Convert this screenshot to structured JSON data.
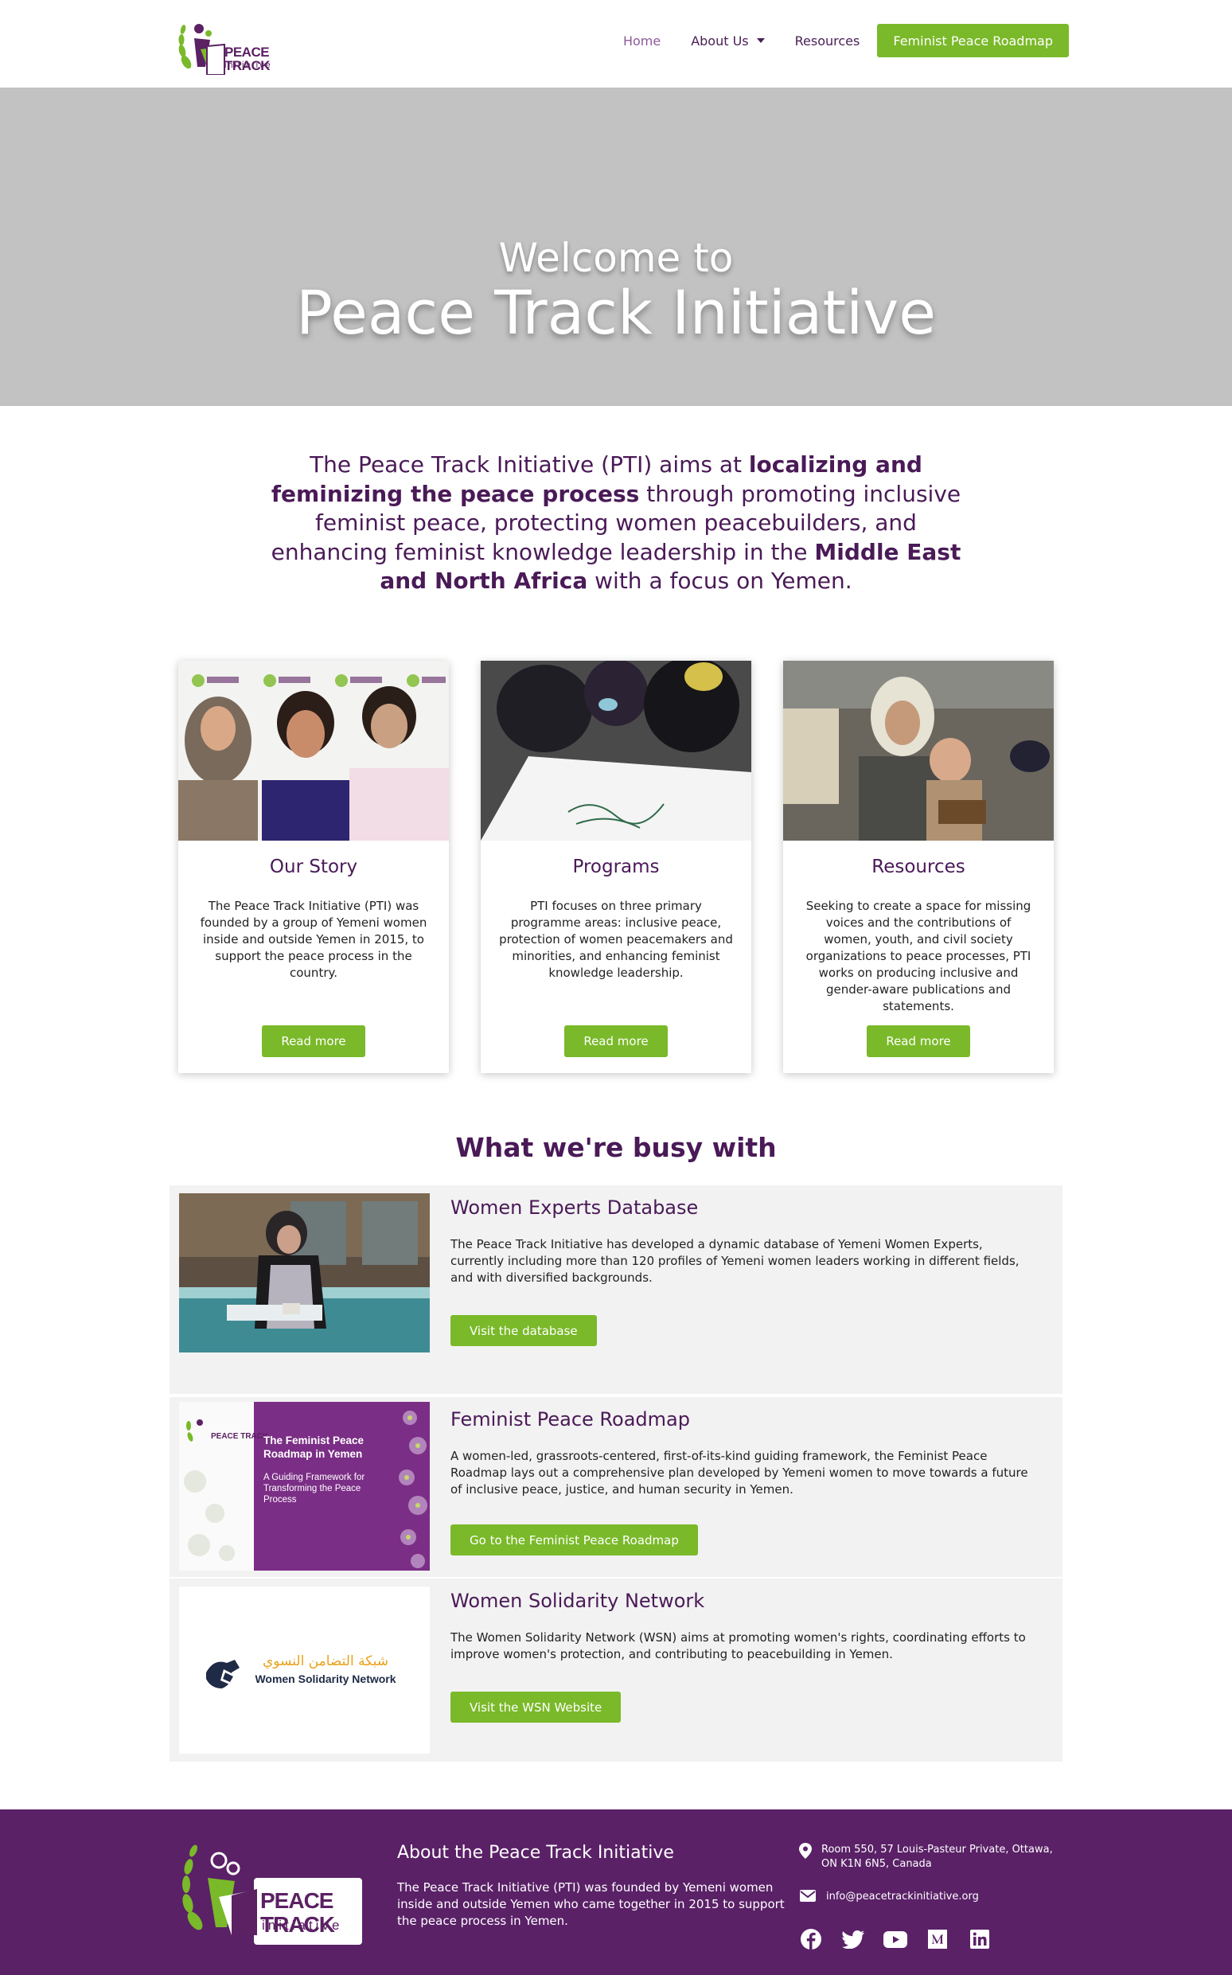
{
  "header": {
    "logo": {
      "text": "PEACE TRACK",
      "sub": "initiative"
    },
    "nav": [
      {
        "label": "Home"
      },
      {
        "label": "About Us"
      },
      {
        "label": "Resources"
      }
    ],
    "cta": "Feminist Peace Roadmap"
  },
  "hero": {
    "line1": "Welcome to",
    "line2": "Peace Track Initiative"
  },
  "intro": {
    "p1": "The Peace Track Initiative (PTI) aims at ",
    "b1": "localizing and feminizing the peace process",
    "p2": " through promoting inclusive feminist peace, protecting women peacebuilders, and enhancing feminist knowledge leadership in the ",
    "b2": "Middle East and North Africa",
    "p3": " with a focus on Yemen."
  },
  "cards": [
    {
      "title": "Our Story",
      "text": "The Peace Track Initiative (PTI) was founded by a group of Yemeni women inside and outside Yemen in 2015, to support the peace process in the country.",
      "button": "Read more"
    },
    {
      "title": "Programs",
      "text": "PTI focuses on three primary programme areas: inclusive peace, protection of women peacemakers and minorities, and enhancing feminist knowledge leadership.",
      "button": "Read more"
    },
    {
      "title": "Resources",
      "text": "Seeking to create a space for missing voices and the contributions of women, youth, and civil society organizations to peace processes, PTI works on producing inclusive and gender-aware publications and statements.",
      "button": "Read more"
    }
  ],
  "busy": {
    "title": "What we're busy with",
    "projects": [
      {
        "title": "Women Experts Database",
        "text": "The Peace Track Initiative has developed a dynamic database of Yemeni Women Experts, currently including more than 120 profiles of Yemeni women leaders working in different fields, and with diversified backgrounds.",
        "button": "Visit the database"
      },
      {
        "title": "Feminist Peace Roadmap",
        "text": "A women-led, grassroots-centered, first-of-its-kind guiding framework, the Feminist Peace Roadmap lays out a comprehensive plan developed by Yemeni women to move towards a future of inclusive peace, justice, and human security in Yemen.",
        "button": "Go to the Feminist Peace Roadmap",
        "cover": {
          "title": "The Feminist Peace Roadmap in Yemen",
          "subtitle": "A Guiding Framework for Transforming the Peace Process",
          "logo": "PEACE TRACK"
        }
      },
      {
        "title": "Women Solidarity Network",
        "text": "The Women Solidarity Network (WSN) aims at promoting women's rights, coordinating efforts to improve women's protection, and contributing to peacebuilding in Yemen.",
        "button": "Visit the WSN Website",
        "logo": {
          "arabic": "شبكة التضامن النسوي",
          "english": "Women Solidarity Network"
        }
      }
    ]
  },
  "footer": {
    "title": "About the Peace Track Initiative",
    "text": "The Peace Track Initiative (PTI) was founded by Yemeni women inside and outside Yemen who came together in 2015 to support the peace process in Yemen.",
    "address": "Room 550, 57 Louis-Pasteur Private, Ottawa, ON K1N 6N5, Canada",
    "email": "info@peacetrackinitiative.org",
    "logo": {
      "text": "PEACE TRACK",
      "sub": "initiative"
    },
    "socials": [
      "facebook-icon",
      "twitter-icon",
      "youtube-icon",
      "medium-icon",
      "linkedin-icon"
    ]
  },
  "colors": {
    "purple": "#4a1a57",
    "green": "#7ab929",
    "footer": "#5a2167",
    "hero": "#c2c2c2"
  }
}
